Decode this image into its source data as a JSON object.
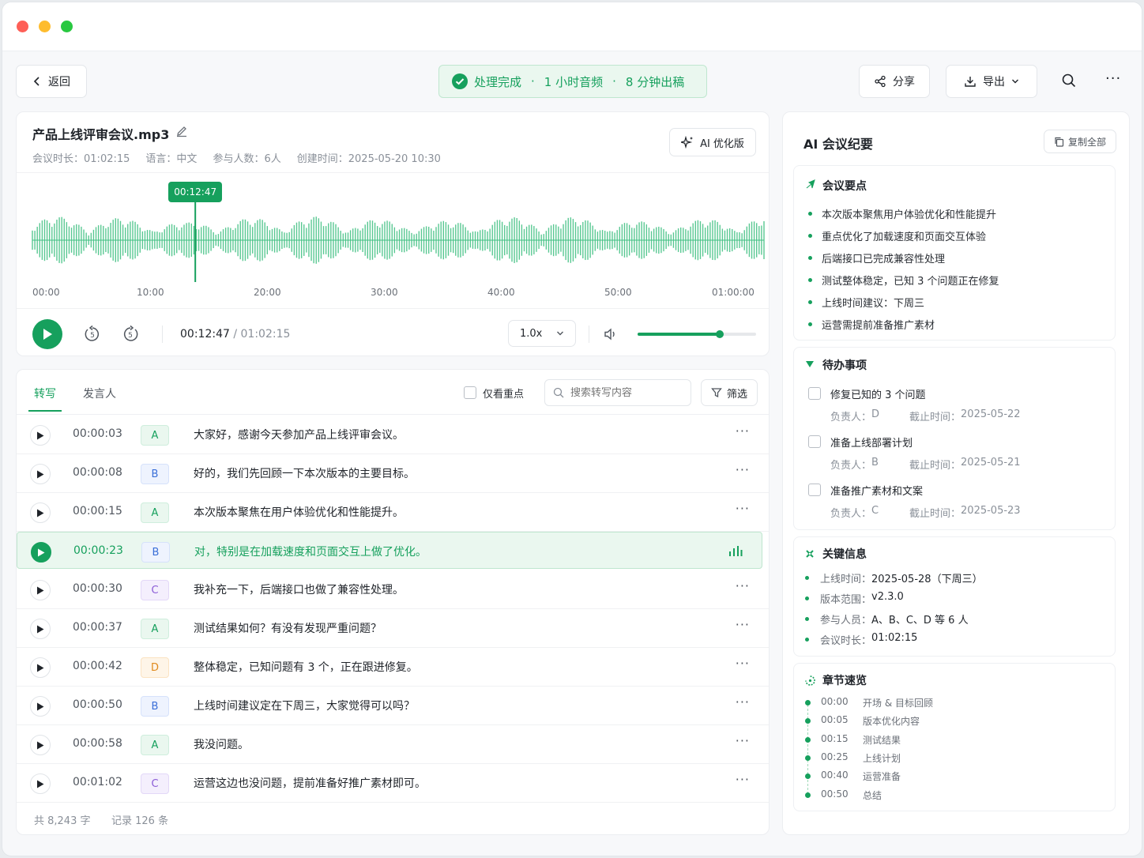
{
  "header": {
    "back_label": "返回",
    "status": {
      "done": "处理完成",
      "audio": "1 小时音频",
      "draft": "8 分钟出稿",
      "sep": "·"
    },
    "share_label": "分享",
    "export_label": "导出"
  },
  "file": {
    "name": "产品上线评审会议.mp3",
    "duration_label": "会议时长：",
    "duration": "01:02:15",
    "lang_label": "语言：",
    "lang": "中文",
    "participants_label": "参与人数：",
    "participants": "6人",
    "created_label": "创建时间：",
    "created": "2025-05-20 10:30",
    "ai_button": "AI 优化版"
  },
  "waveform": {
    "marker": "00:12:47",
    "marker_fraction": 0.2055,
    "ticks": [
      "00:00",
      "10:00",
      "20:00",
      "30:00",
      "40:00",
      "50:00",
      "01:00:00"
    ]
  },
  "player": {
    "current": "00:12:47",
    "separator": "/",
    "total": "01:02:15",
    "speed": "1.0x",
    "rewind": "5",
    "forward": "5",
    "volume_fraction": 0.69
  },
  "transcript": {
    "tabs": [
      "转写",
      "发言人"
    ],
    "filter_key_label": "仅看重点",
    "search_placeholder": "搜索转写内容",
    "filter_label": "筛选",
    "rows": [
      {
        "time": "00:00:03",
        "speaker": "A",
        "text": "大家好，感谢今天参加产品上线评审会议。"
      },
      {
        "time": "00:00:08",
        "speaker": "B",
        "text": "好的，我们先回顾一下本次版本的主要目标。"
      },
      {
        "time": "00:00:15",
        "speaker": "A",
        "text": "本次版本聚焦在用户体验优化和性能提升。"
      },
      {
        "time": "00:00:23",
        "speaker": "B",
        "text": "对，特别是在加载速度和页面交互上做了优化。"
      },
      {
        "time": "00:00:30",
        "speaker": "C",
        "text": "我补充一下，后端接口也做了兼容性处理。"
      },
      {
        "time": "00:00:37",
        "speaker": "A",
        "text": "测试结果如何？有没有发现严重问题？"
      },
      {
        "time": "00:00:42",
        "speaker": "D",
        "text": "整体稳定，已知问题有 3 个，正在跟进修复。"
      },
      {
        "time": "00:00:50",
        "speaker": "B",
        "text": "上线时间建议定在下周三，大家觉得可以吗？"
      },
      {
        "time": "00:00:58",
        "speaker": "A",
        "text": "我没问题。"
      },
      {
        "time": "00:01:02",
        "speaker": "C",
        "text": "运营这边也没问题，提前准备好推广素材即可。"
      }
    ],
    "footer_words": "共 8,243 字",
    "footer_records": "记录 126 条"
  },
  "summary": {
    "title": "AI 会议纪要",
    "copy_all": "复制全部",
    "key_points_title": "会议要点",
    "key_points": [
      "本次版本聚焦用户体验优化和性能提升",
      "重点优化了加载速度和页面交互体验",
      "后端接口已完成兼容性处理",
      "测试整体稳定，已知 3 个问题正在修复",
      "上线时间建议：下周三",
      "运营需提前准备推广素材"
    ],
    "todo_title": "待办事项",
    "owner_label": "负责人：",
    "deadline_label": "截止时间：",
    "todos": [
      {
        "task": "修复已知的 3 个问题",
        "owner": "D",
        "deadline": "2025-05-22"
      },
      {
        "task": "准备上线部署计划",
        "owner": "B",
        "deadline": "2025-05-21"
      },
      {
        "task": "准备推广素材和文案",
        "owner": "C",
        "deadline": "2025-05-23"
      }
    ],
    "info_title": "关键信息",
    "info": [
      {
        "label": "上线时间：",
        "value": "2025-05-28（下周三）"
      },
      {
        "label": "版本范围：",
        "value": "v2.3.0"
      },
      {
        "label": "参与人员：",
        "value": "A、B、C、D 等 6 人"
      },
      {
        "label": "会议时长：",
        "value": "01:02:15"
      }
    ],
    "chapters_title": "章节速览",
    "chapters": [
      {
        "time": "00:00",
        "title": "开场 & 目标回顾"
      },
      {
        "time": "00:05",
        "title": "版本优化内容"
      },
      {
        "time": "00:15",
        "title": "测试结果"
      },
      {
        "time": "00:25",
        "title": "上线计划"
      },
      {
        "time": "00:40",
        "title": "运营准备"
      },
      {
        "time": "00:50",
        "title": "总结"
      }
    ]
  },
  "colors": {
    "accent": "#16a05d",
    "accent_light": "#eaf7ef",
    "wave": "#3dbf80"
  }
}
